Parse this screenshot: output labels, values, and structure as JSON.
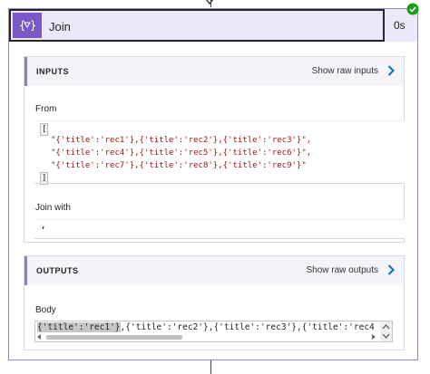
{
  "action": {
    "title": "Join",
    "duration": "0s",
    "icon": "curly-braces-function-icon",
    "status": "succeeded",
    "accent_color": "#7a58c7",
    "status_color": "#13a10e"
  },
  "inputs": {
    "section_title": "INPUTS",
    "show_raw_label": "Show raw inputs",
    "from_label": "From",
    "from_open_bracket": "[",
    "from_lines": [
      "\"{'title':'rec1'},{'title':'rec2'},{'title':'rec3'}\",",
      "\"{'title':'rec4'},{'title':'rec5'},{'title':'rec6'}\",",
      "\"{'title':'rec7'},{'title':'rec8'},{'title':'rec9'}\""
    ],
    "from_close_bracket": "]",
    "join_with_label": "Join with",
    "join_with_value": ","
  },
  "outputs": {
    "section_title": "OUTPUTS",
    "show_raw_label": "Show raw outputs",
    "body_label": "Body",
    "body_highlight": "{'title':'rec1'}",
    "body_rest": ",{'title':'rec2'},{'title':'rec3'},{'title':'rec4"
  }
}
